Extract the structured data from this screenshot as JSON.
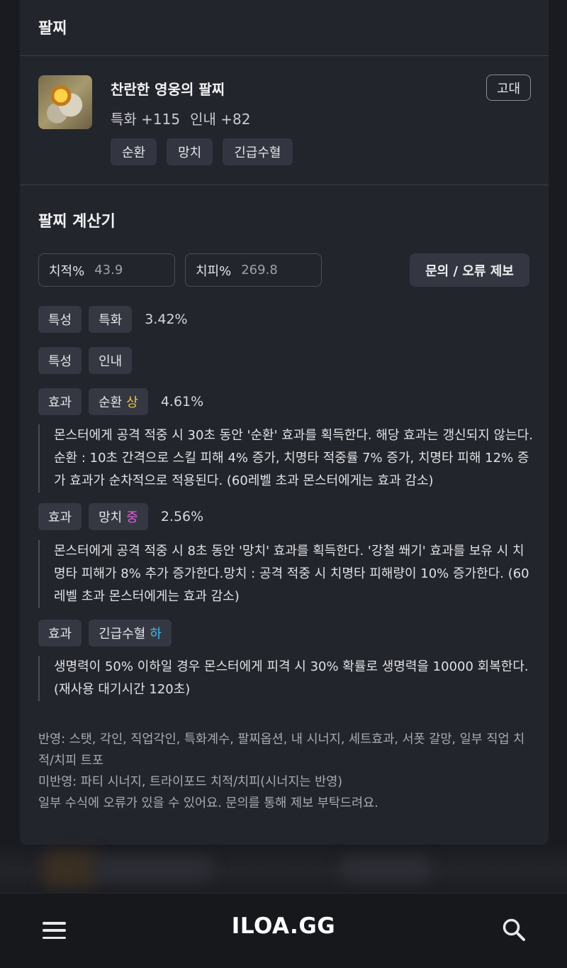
{
  "header": {
    "title": "팔찌"
  },
  "item": {
    "name": "찬란한 영웅의 팔찌",
    "stats": [
      "특화 +115",
      "인내 +82"
    ],
    "grade": "고대",
    "tags": [
      "순환",
      "망치",
      "긴급수혈"
    ]
  },
  "calculator": {
    "title": "팔찌 계산기",
    "crit_label": "치적%",
    "crit_value": "43.9",
    "critdmg_label": "치피%",
    "critdmg_value": "269.8",
    "report_button": "문의 / 오류 제보",
    "rows": [
      {
        "type": "특성",
        "name": "특화",
        "grade": "",
        "value": "3.42%"
      },
      {
        "type": "특성",
        "name": "인내",
        "grade": "",
        "value": ""
      },
      {
        "type": "효과",
        "name": "순환",
        "grade": "상",
        "value": "4.61%",
        "description": "몬스터에게 공격 적중 시 30초 동안 '순환' 효과를 획득한다. 해당 효과는 갱신되지 않는다. 순환 : 10초 간격으로 스킬 피해 4% 증가, 치명타 적중률 7% 증가, 치명타 피해 12% 증가 효과가 순차적으로 적용된다. (60레벨 초과 몬스터에게는 효과 감소)"
      },
      {
        "type": "효과",
        "name": "망치",
        "grade": "중",
        "value": "2.56%",
        "description": "몬스터에게 공격 적중 시 8초 동안 '망치' 효과를 획득한다. '강철 쐐기' 효과를 보유 시 치명타 피해가 8% 추가 증가한다.망치 : 공격 적중 시 치명타 피해량이 10% 증가한다. (60레벨 초과 몬스터에게는 효과 감소)"
      },
      {
        "type": "효과",
        "name": "긴급수혈",
        "grade": "하",
        "value": "",
        "description": "생명력이 50% 이하일 경우 몬스터에게 피격 시 30% 확률로 생명력을 10000 회복한다. (재사용 대기시간 120초)"
      }
    ],
    "notes": [
      "반영: 스탯, 각인, 직업각인, 특화계수, 팔찌옵션, 내 시너지, 세트효과, 서폿 갈망, 일부 직업 치적/치피 트포",
      "미반영: 파티 시너지, 트라이포드 치적/치피(시너지는 반영)",
      "일부 수식에 오류가 있을 수 있어요. 문의를 통해 제보 부탁드려요."
    ]
  },
  "nav": {
    "logo": "ILOA.GG",
    "menu_icon": "menu-icon",
    "search_icon": "search-icon"
  },
  "colors": {
    "grade_sang": "#f5c242",
    "grade_jung": "#e55ee0",
    "grade_ha": "#3fb8f0"
  }
}
